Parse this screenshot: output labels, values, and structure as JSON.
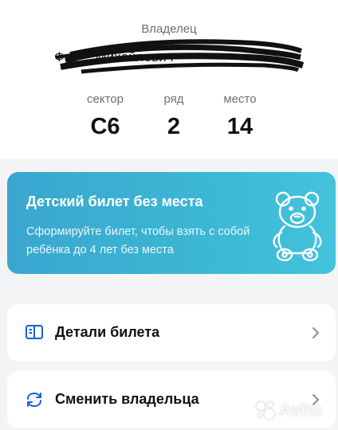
{
  "owner": {
    "label": "Владелец",
    "name": "Ф… …Михайлович"
  },
  "seat": {
    "sector_label": "сектор",
    "sector_value": "C6",
    "row_label": "ряд",
    "row_value": "2",
    "place_label": "место",
    "place_value": "14"
  },
  "child_ticket": {
    "title": "Детский билет без места",
    "description": "Сформируйте билет, чтобы взять с собой ребёнка до 4 лет без места",
    "icon": "teddy-bear-icon"
  },
  "actions": [
    {
      "label": "Детали билета",
      "icon": "book-icon"
    },
    {
      "label": "Сменить владельца",
      "icon": "swap-arrows-icon"
    }
  ],
  "watermark": {
    "brand": "Avito"
  },
  "colors": {
    "accent": "#3db4d3",
    "icon_blue": "#1a5fd8",
    "background": "#f3f4f6"
  }
}
